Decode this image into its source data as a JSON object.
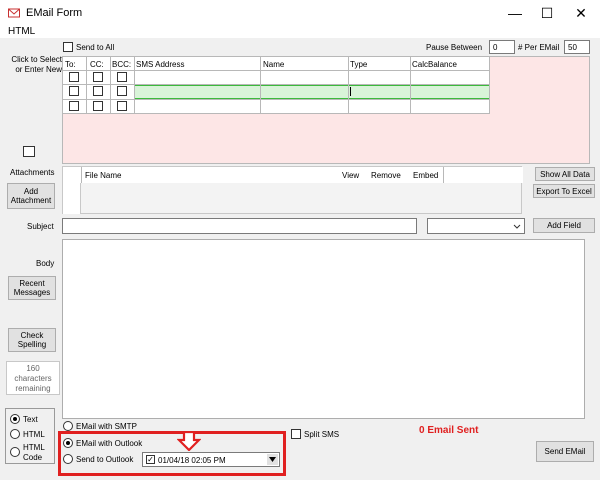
{
  "window": {
    "title": "EMail Form",
    "minimize": "—",
    "maximize": "☐",
    "close": "✕"
  },
  "menu": {
    "html": "HTML"
  },
  "recipients": {
    "send_to_all": "Send to All",
    "pause_between_label": "Pause Between",
    "pause_between_value": "0",
    "per_email_label": "# Per EMail",
    "per_email_value": "50",
    "click_to_select": "Click to Select or Enter New",
    "columns": [
      "To:",
      "CC:",
      "BCC:",
      "SMS Address",
      "Name",
      "Type",
      "CalcBalance"
    ]
  },
  "attachments": {
    "label": "Attachments",
    "add_button": "Add Attachment",
    "columns": [
      "File Name",
      "View",
      "Remove",
      "Embed"
    ],
    "show_all_data": "Show All Data",
    "export_to_excel": "Export To Excel"
  },
  "subject": {
    "label": "Subject",
    "value": "",
    "add_field": "Add Field"
  },
  "body": {
    "label": "Body",
    "recent_messages": "Recent Messages",
    "check_spelling": "Check Spelling",
    "chars_remaining": "160 characters remaining"
  },
  "format": {
    "text": "Text",
    "html": "HTML",
    "html_code": "HTML Code",
    "selected": "text"
  },
  "send_options": {
    "smtp": "EMail with SMTP",
    "outlook": "EMail with Outlook",
    "send_to_outlook": "Send to Outlook",
    "selected": "outlook",
    "datetime": "01/04/18 02:05 PM",
    "split_sms": "Split SMS",
    "status": "0 Email Sent",
    "send_button": "Send EMail"
  },
  "colors": {
    "highlight": "#e02020",
    "selected_row": "#d9f4d9",
    "pink": "#fde6e6"
  }
}
